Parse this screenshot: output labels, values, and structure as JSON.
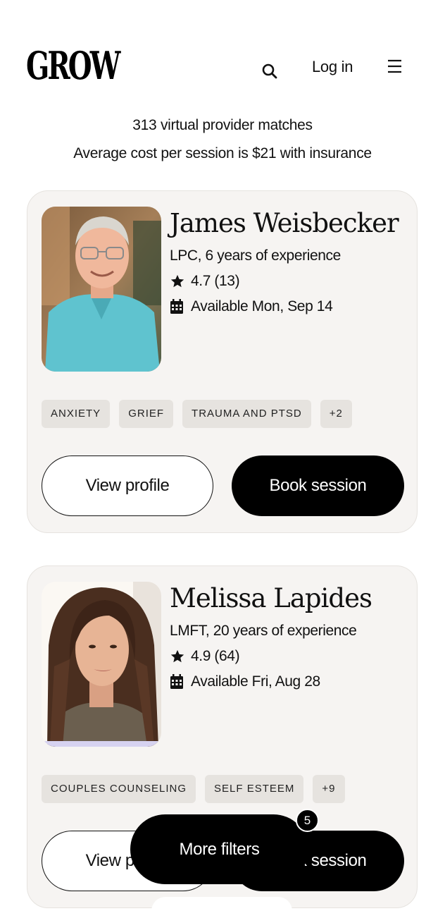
{
  "header": {
    "logo": "GROW",
    "login_label": "Log in",
    "search_icon": "search-icon",
    "menu_icon": "hamburger-menu-icon"
  },
  "summary": {
    "matches": "313 virtual provider matches",
    "cost": "Average cost per session is $21 with insurance"
  },
  "providers": [
    {
      "name": "James Weisbecker",
      "credentials": "LPC, 6 years of experience",
      "rating": "4.7 (13)",
      "availability": "Available Mon, Sep 14",
      "tags": [
        "ANXIETY",
        "GRIEF",
        "TRAUMA AND PTSD",
        "+2"
      ],
      "view_label": "View profile",
      "book_label": "Book session"
    },
    {
      "name": "Melissa Lapides",
      "credentials": "LMFT, 20 years of experience",
      "rating": "4.9 (64)",
      "availability": "Available Fri, Aug 28",
      "tags": [
        "COUPLES COUNSELING",
        "SELF ESTEEM",
        "+9"
      ],
      "view_label": "View profile",
      "book_label": "Book session"
    }
  ],
  "filters": {
    "label": "More filters",
    "count": "5"
  },
  "colors": {
    "card_bg": "#f6f4f2",
    "tag_bg": "#e6e3df",
    "primary": "#000000"
  }
}
